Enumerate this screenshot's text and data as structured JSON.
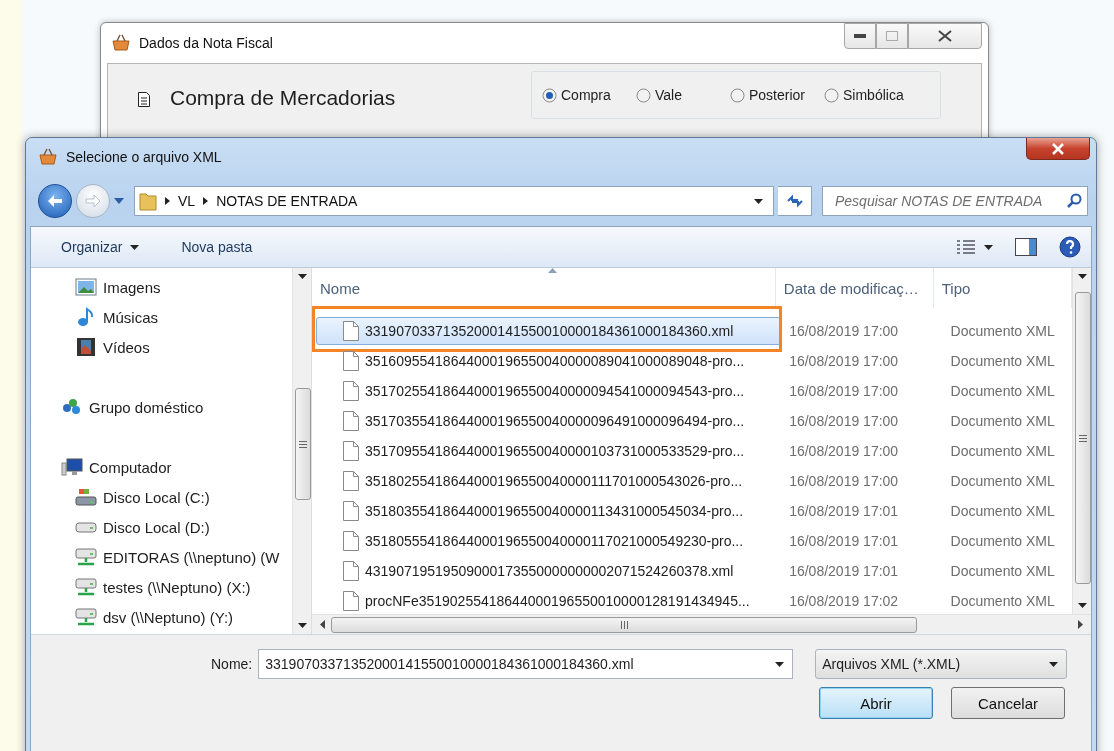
{
  "back_window": {
    "title": "Dados da Nota Fiscal",
    "heading": "Compra de Mercadorias",
    "options": [
      {
        "label": "Compra",
        "selected": true
      },
      {
        "label": "Vale",
        "selected": false
      },
      {
        "label": "Posterior",
        "selected": false
      },
      {
        "label": "Simbólica",
        "selected": false
      }
    ]
  },
  "dialog": {
    "title": "Selecione o arquivo XML",
    "path": [
      "VL",
      "NOTAS DE ENTRADA"
    ],
    "search": {
      "placeholder": "Pesquisar NOTAS DE ENTRADA"
    },
    "toolbar": [
      {
        "label": "Organizar",
        "kind": "menu"
      },
      {
        "label": "Nova pasta",
        "kind": "button"
      }
    ],
    "nav": {
      "libraries": [
        {
          "label": "Imagens",
          "kind": "pictures"
        },
        {
          "label": "Músicas",
          "kind": "music"
        },
        {
          "label": "Vídeos",
          "kind": "videos"
        }
      ],
      "groups": [
        {
          "label": "Grupo doméstico",
          "kind": "homegroup"
        },
        {
          "label": "Computador",
          "kind": "computer",
          "children": [
            {
              "label": "Disco Local (C:)",
              "kind": "system-drive"
            },
            {
              "label": "Disco Local (D:)",
              "kind": "drive"
            },
            {
              "label": "EDITORAS (\\\\neptuno) (W",
              "kind": "network"
            },
            {
              "label": "testes (\\\\Neptuno) (X:)",
              "kind": "network"
            },
            {
              "label": "dsv (\\\\Neptuno) (Y:)",
              "kind": "network"
            }
          ]
        }
      ]
    },
    "columns": [
      "Nome",
      "Data de modificaç…",
      "Tipo"
    ],
    "rows": [
      {
        "name": "33190703371352000141550010000184361000184360.xml",
        "modified": "16/08/2019 17:00",
        "type": "Documento XML",
        "selected": true,
        "marked": true
      },
      {
        "name": "35160955418644000196550040000089041000089048-pro...",
        "modified": "16/08/2019 17:00",
        "type": "Documento XML",
        "selected": false,
        "marked": false
      },
      {
        "name": "35170255418644000196550040000094541000094543-pro...",
        "modified": "16/08/2019 17:00",
        "type": "Documento XML",
        "selected": false,
        "marked": false
      },
      {
        "name": "35170355418644000196550040000096491000096494-pro...",
        "modified": "16/08/2019 17:00",
        "type": "Documento XML",
        "selected": false,
        "marked": false
      },
      {
        "name": "35170955418644000196550040000103731000533529-pro...",
        "modified": "16/08/2019 17:00",
        "type": "Documento XML",
        "selected": false,
        "marked": false
      },
      {
        "name": "35180255418644000196550040000111701000543026-pro...",
        "modified": "16/08/2019 17:00",
        "type": "Documento XML",
        "selected": false,
        "marked": false
      },
      {
        "name": "35180355418644000196550040000113431000545034-pro...",
        "modified": "16/08/2019 17:01",
        "type": "Documento XML",
        "selected": false,
        "marked": false
      },
      {
        "name": "35180555418644000196550040000117021000549230-pro...",
        "modified": "16/08/2019 17:01",
        "type": "Documento XML",
        "selected": false,
        "marked": false
      },
      {
        "name": "43190719519509000173550000000002071524260378.xml",
        "modified": "16/08/2019 17:01",
        "type": "Documento XML",
        "selected": false,
        "marked": false
      },
      {
        "name": "procNFe35190255418644000196550010000128191434945...",
        "modified": "16/08/2019 17:02",
        "type": "Documento XML",
        "selected": false,
        "marked": false
      }
    ],
    "file_name": {
      "label": "Nome:",
      "value": "33190703371352000141550010000184361000184360.xml"
    },
    "filter": "Arquivos XML (*.XML)",
    "buttons": [
      {
        "label": "Abrir",
        "kind": "default"
      },
      {
        "label": "Cancelar",
        "kind": "normal"
      }
    ]
  }
}
